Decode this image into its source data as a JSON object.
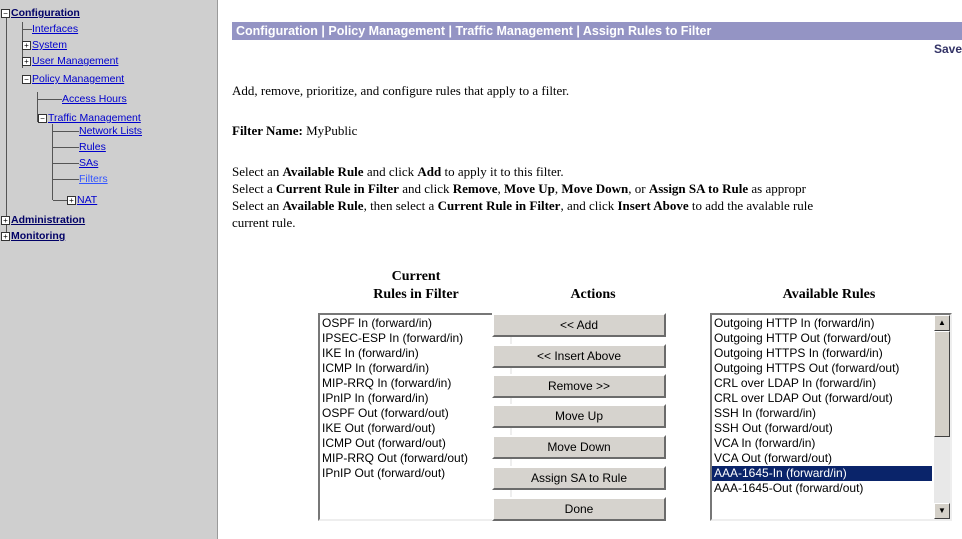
{
  "nav": {
    "configuration": "Configuration",
    "interfaces": "Interfaces",
    "system": "System",
    "user_management": "User Management",
    "policy_management": "Policy Management",
    "access_hours": "Access Hours",
    "traffic_management": "Traffic Management",
    "network_lists": "Network Lists",
    "rules": "Rules",
    "sas": "SAs",
    "filters": "Filters",
    "nat": "NAT",
    "administration": "Administration",
    "monitoring": "Monitoring",
    "expand_glyph": "+",
    "collapse_glyph": "−"
  },
  "header": {
    "breadcrumb": "Configuration | Policy Management | Traffic Management | Assign Rules to Filter",
    "save": "Save"
  },
  "content": {
    "intro": "Add, remove, prioritize, and configure rules that apply to a filter.",
    "filter_name_label": "Filter Name:",
    "filter_name_value": "MyPublic",
    "instr1": [
      "Select an ",
      "Available Rule",
      " and click ",
      "Add",
      " to apply it to this filter."
    ],
    "instr2": [
      "Select a ",
      "Current Rule in Filter",
      " and click ",
      "Remove",
      ", ",
      "Move Up",
      ", ",
      "Move Down",
      ", or ",
      "Assign SA to Rule",
      " as appropr"
    ],
    "instr3": [
      "Select an ",
      "Available Rule",
      ", then select a ",
      "Current Rule in Filter",
      ", and click ",
      "Insert Above",
      " to add the avalable rule"
    ],
    "instr3_cont": "current rule."
  },
  "columns": {
    "current_line1": "Current",
    "current_line2": "Rules in Filter",
    "actions": "Actions",
    "available": "Available Rules"
  },
  "current_rules": [
    "OSPF In (forward/in)",
    "IPSEC-ESP In (forward/in)",
    "IKE In (forward/in)",
    "ICMP In (forward/in)",
    "MIP-RRQ In (forward/in)",
    "IPnIP In (forward/in)",
    "OSPF Out (forward/out)",
    "IKE Out (forward/out)",
    "ICMP Out (forward/out)",
    "MIP-RRQ Out (forward/out)",
    "IPnIP Out (forward/out)"
  ],
  "available_rules": [
    "Outgoing HTTP In (forward/in)",
    "Outgoing HTTP Out (forward/out)",
    "Outgoing HTTPS In (forward/in)",
    "Outgoing HTTPS Out (forward/out)",
    "CRL over LDAP In (forward/in)",
    "CRL over LDAP Out (forward/out)",
    "SSH In (forward/in)",
    "SSH Out (forward/out)",
    "VCA In (forward/in)",
    "VCA Out (forward/out)",
    "AAA-1645-In (forward/in)",
    "AAA-1645-Out (forward/out)"
  ],
  "available_selected": "AAA-1645-In (forward/in)",
  "actions": {
    "add": "<< Add",
    "insert_above": "<< Insert Above",
    "remove": "Remove >>",
    "move_up": "Move Up",
    "move_down": "Move Down",
    "assign_sa": "Assign SA to Rule",
    "done": "Done"
  },
  "scroll": {
    "up_glyph": "▲",
    "down_glyph": "▼"
  },
  "colors": {
    "title_bar": "#9494c4",
    "nav_bg": "#cfcfcf",
    "selection": "#0a246a"
  }
}
